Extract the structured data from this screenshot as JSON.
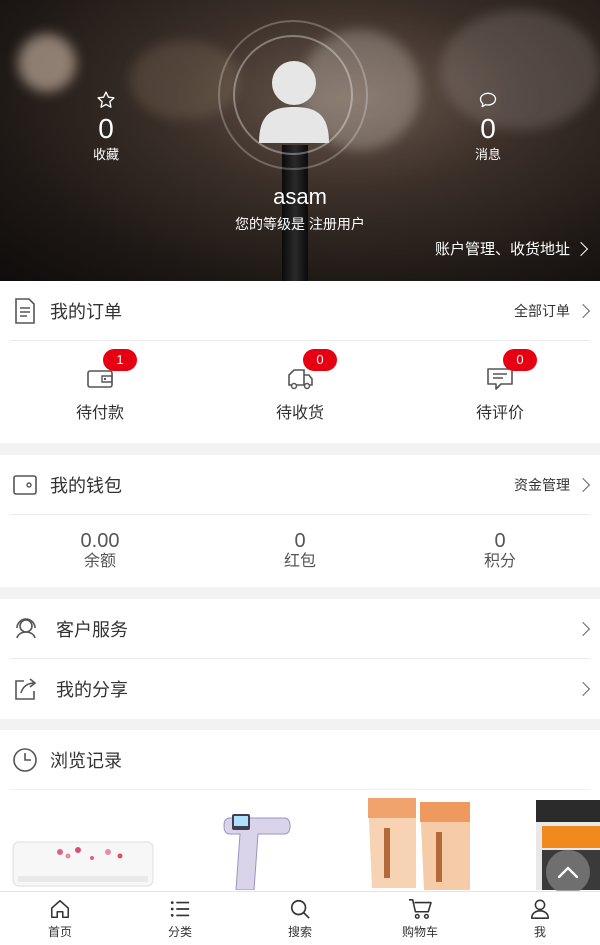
{
  "header": {
    "favorites": {
      "icon": "star-icon",
      "count": "0",
      "label": "收藏"
    },
    "messages": {
      "icon": "chat-bubble-icon",
      "count": "0",
      "label": "消息"
    },
    "username": "asam",
    "level_text": "您的等级是 注册用户",
    "account_link": "账户管理、收货地址"
  },
  "orders": {
    "title": "我的订单",
    "link": "全部订单",
    "items": [
      {
        "label": "待付款",
        "badge": "1",
        "icon": "wallet-icon"
      },
      {
        "label": "待收货",
        "badge": "0",
        "icon": "truck-icon"
      },
      {
        "label": "待评价",
        "badge": "0",
        "icon": "comment-icon"
      }
    ]
  },
  "wallet": {
    "title": "我的钱包",
    "link": "资金管理",
    "items": [
      {
        "value": "0.00",
        "label": "余额"
      },
      {
        "value": "0",
        "label": "红包"
      },
      {
        "value": "0",
        "label": "积分"
      }
    ]
  },
  "menu": {
    "service": "客户服务",
    "share": "我的分享"
  },
  "history": {
    "title": "浏览记录"
  },
  "tabbar": [
    {
      "label": "首页",
      "icon": "home-icon"
    },
    {
      "label": "分类",
      "icon": "list-icon"
    },
    {
      "label": "搜索",
      "icon": "search-icon"
    },
    {
      "label": "购物车",
      "icon": "cart-icon"
    },
    {
      "label": "我",
      "icon": "user-icon"
    }
  ],
  "colors": {
    "badge": "#e60012",
    "text": "#333333",
    "background": "#f2f2f2"
  }
}
